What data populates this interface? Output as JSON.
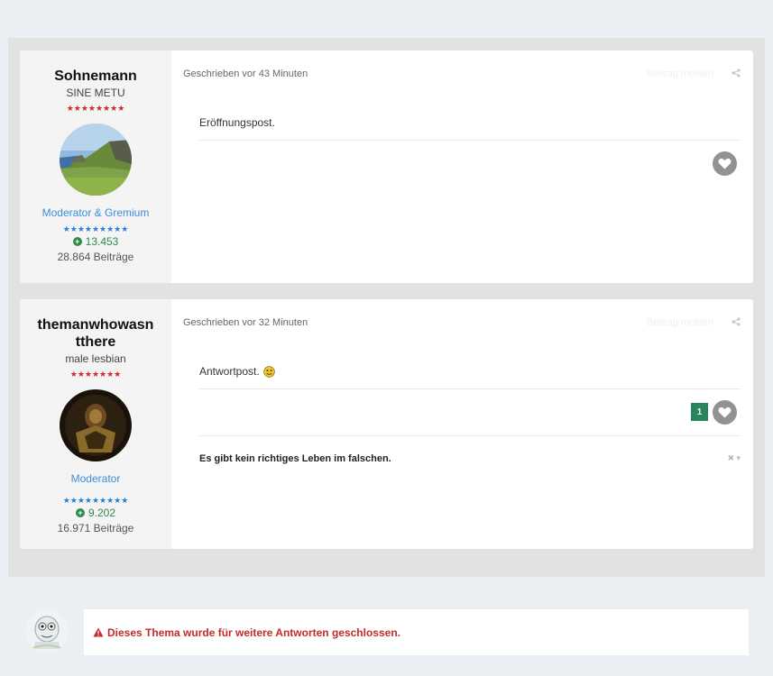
{
  "posts": [
    {
      "author": "Sohnemann",
      "title": "SINE METU",
      "rank_stars": "★★★★★★★★",
      "group": "Moderator & Gremium",
      "group_stars": "★★★★★★★★★",
      "reputation": "13.453",
      "post_count": "28.864 Beiträge",
      "meta": "Geschrieben vor 43 Minuten",
      "report_label": "Beitrag melden",
      "body": "Eröffnungspost.",
      "likes": null,
      "signature": null
    },
    {
      "author": "themanwhowasntthere",
      "title": "male lesbian",
      "rank_stars": "★★★★★★★",
      "group": "Moderator",
      "group_stars": "★★★★★★★★★",
      "reputation": "9.202",
      "post_count": "16.971 Beiträge",
      "meta": "Geschrieben vor 32 Minuten",
      "report_label": "Beitrag melden",
      "body": "Antwortpost.",
      "likes": "1",
      "signature": "Es gibt kein richtiges Leben im falschen."
    }
  ],
  "closed_notice": "Dieses Thema wurde für weitere Antworten geschlossen.",
  "colors": {
    "accent_blue": "#3d8fd6",
    "rep_green": "#2f8a4a",
    "like_green": "#26855b",
    "closed_red": "#c42b2b"
  }
}
